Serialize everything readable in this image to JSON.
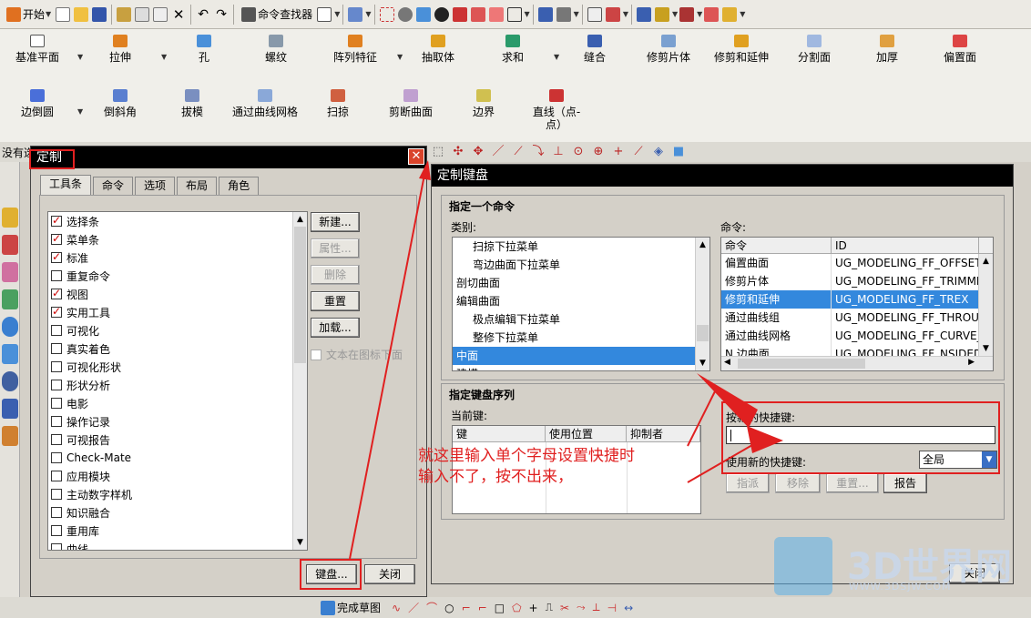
{
  "toolbar1": {
    "start_label": "开始",
    "command_finder_label": "命令查找器"
  },
  "ribbon": {
    "row1": [
      "基准平面",
      "拉伸",
      "孔",
      "螺纹",
      "阵列特征",
      "抽取体",
      "求和",
      "缝合",
      "修剪片体",
      "修剪和延伸",
      "分割面",
      "加厚",
      "偏置面"
    ],
    "row2": [
      "边倒圆",
      "倒斜角",
      "拔模",
      "通过曲线网格",
      "扫掠",
      "剪断曲面",
      "边界",
      "直线（点-",
      "点）"
    ]
  },
  "toolbar3": {
    "left_text": "没有选"
  },
  "dialog_customize": {
    "title": "定制",
    "tabs": [
      "工具条",
      "命令",
      "选项",
      "布局",
      "角色"
    ],
    "items": [
      {
        "label": "选择条",
        "checked": true
      },
      {
        "label": "菜单条",
        "checked": true
      },
      {
        "label": "标准",
        "checked": true
      },
      {
        "label": "重复命令",
        "checked": false
      },
      {
        "label": "视图",
        "checked": true
      },
      {
        "label": "实用工具",
        "checked": true
      },
      {
        "label": "可视化",
        "checked": false
      },
      {
        "label": "真实着色",
        "checked": false
      },
      {
        "label": "可视化形状",
        "checked": false
      },
      {
        "label": "形状分析",
        "checked": false
      },
      {
        "label": "电影",
        "checked": false
      },
      {
        "label": "操作记录",
        "checked": false
      },
      {
        "label": "可视报告",
        "checked": false
      },
      {
        "label": "Check-Mate",
        "checked": false
      },
      {
        "label": "应用模块",
        "checked": false
      },
      {
        "label": "主动数字样机",
        "checked": false
      },
      {
        "label": "知识融合",
        "checked": false
      },
      {
        "label": "重用库",
        "checked": false
      },
      {
        "label": "曲线",
        "checked": false
      }
    ],
    "buttons": {
      "new": "新建...",
      "properties": "属性...",
      "delete": "删除",
      "reset": "重置",
      "load": "加载...",
      "text_below_icon": "文本在图标下面",
      "keyboard": "键盘...",
      "close": "关闭"
    }
  },
  "dialog_keyboard": {
    "title": "定制键盘",
    "group_specify_command": "指定一个命令",
    "category_label": "类别:",
    "categories": [
      {
        "label": "扫掠下拉菜单",
        "indent": 1
      },
      {
        "label": "弯边曲面下拉菜单",
        "indent": 1
      },
      {
        "label": "剖切曲面",
        "indent": 0
      },
      {
        "label": "编辑曲面",
        "indent": 0
      },
      {
        "label": "极点编辑下拉菜单",
        "indent": 1
      },
      {
        "label": "整修下拉菜单",
        "indent": 1
      },
      {
        "label": "中面",
        "indent": 0,
        "selected": true
      },
      {
        "label": "建模",
        "indent": 0
      }
    ],
    "command_label": "命令:",
    "command_columns": [
      "命令",
      "ID"
    ],
    "commands": [
      {
        "name": "偏置曲面",
        "id": "UG_MODELING_FF_OFFSET"
      },
      {
        "name": "修剪片体",
        "id": "UG_MODELING_FF_TRIMME"
      },
      {
        "name": "修剪和延伸",
        "id": "UG_MODELING_FF_TREX",
        "selected": true
      },
      {
        "name": "通过曲线组",
        "id": "UG_MODELING_FF_THROU."
      },
      {
        "name": "通过曲线网格",
        "id": "UG_MODELING_FF_CURVE_"
      },
      {
        "name": "N 边曲面",
        "id": "UG_MODELING_FF_NSIDED"
      }
    ],
    "group_key_sequence": "指定键盘序列",
    "current_keys_label": "当前键:",
    "key_columns": [
      "键",
      "使用位置",
      "抑制者"
    ],
    "new_shortcut_label": "按新的快捷键:",
    "new_shortcut_value": "",
    "use_shortcut_label": "使用新的快捷键:",
    "scope_value": "全局",
    "buttons": {
      "assign": "指派",
      "remove": "移除",
      "reset": "重置...",
      "report": "报告",
      "close": "关闭"
    }
  },
  "annotation": {
    "line1": "就这里输入单个字母设置快捷时",
    "line2": "输入不了，按不出来，"
  },
  "bottombar": {
    "finish_sketch": "完成草图"
  },
  "watermark": {
    "brand": "3D世界网",
    "url": "WWW.3DSJW.COM"
  },
  "colors": {
    "annotation_red": "#e02020",
    "selection_blue": "#3388dd"
  }
}
